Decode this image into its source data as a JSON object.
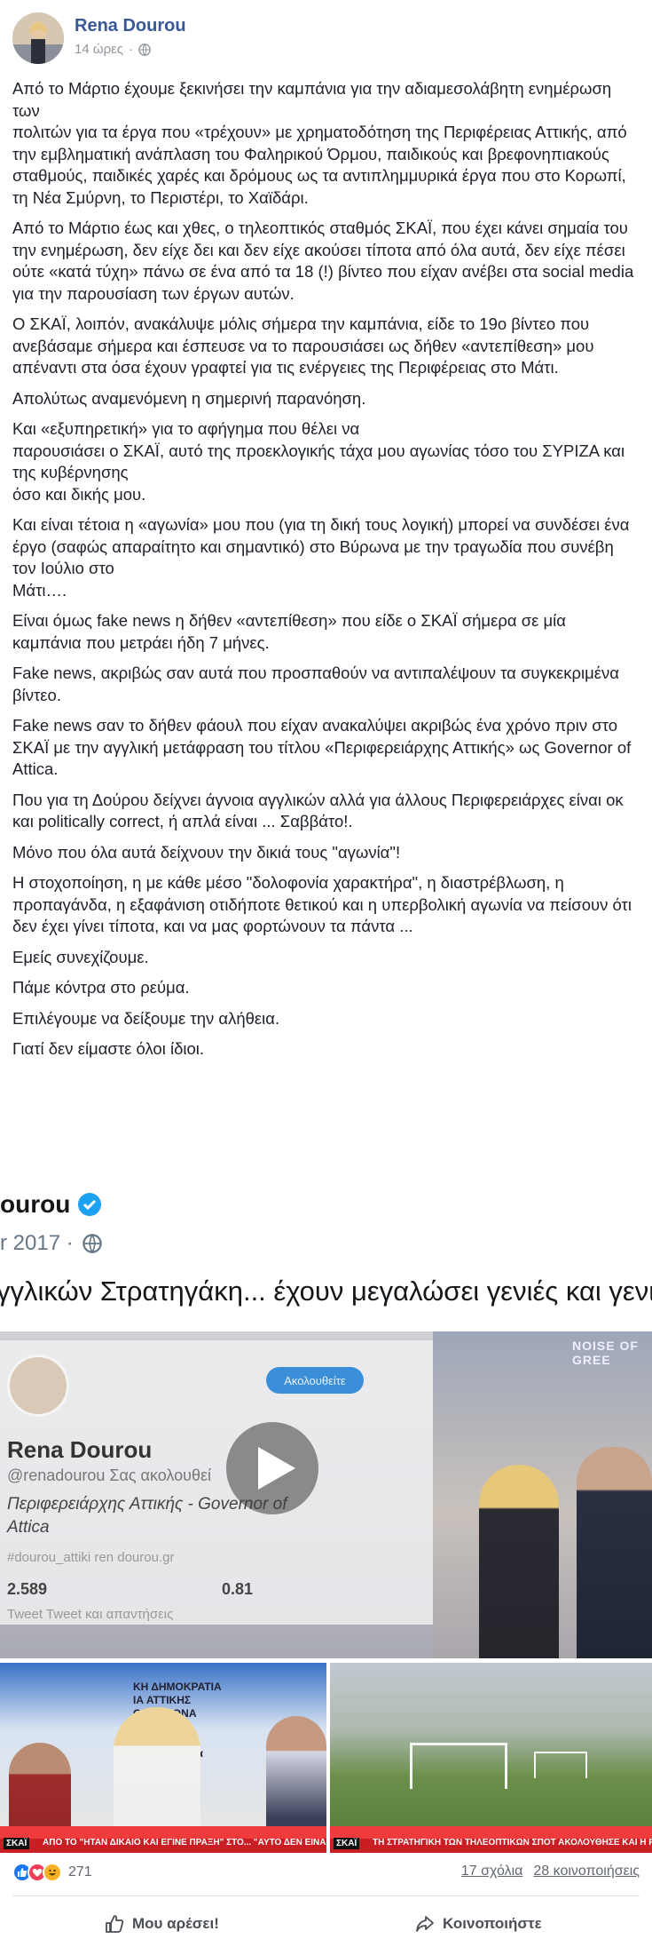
{
  "post": {
    "author": "Rena Dourou",
    "time": "14 ώρες",
    "privacy_icon": "globe-icon",
    "paragraphs": [
      "Από το Μάρτιο έχουμε ξεκινήσει την καμπάνια για την αδιαμεσολάβητη ενημέρωση των\nπολιτών για τα έργα που «τρέχουν» με χρηματοδότηση της Περιφέρειας Αττικής, από την εμβληματική ανάπλαση του Φαληρικού Όρμου, παιδικούς και βρεφονηπιακούς σταθμούς, παιδικές χαρές και δρόμους ως τα αντιπλημμυρικά έργα που στο Κορωπί, τη Νέα Σμύρνη, το Περιστέρι, το Χαϊδάρι.",
      "Από το Μάρτιο έως και χθες, ο τηλεοπτικός σταθμός ΣΚΑΪ, που έχει κάνει σημαία του την ενημέρωση, δεν είχε δει και δεν είχε ακούσει τίποτα από όλα αυτά, δεν είχε πέσει ούτε «κατά τύχη» πάνω σε ένα από τα 18 (!) βίντεο που είχαν ανέβει στα social media για την παρουσίαση των έργων αυτών.",
      "Ο ΣΚΑΪ, λοιπόν, ανακάλυψε μόλις σήμερα την καμπάνια, είδε το 19ο βίντεο που ανεβάσαμε σήμερα και έσπευσε να το παρουσιάσει ως δήθεν «αντεπίθεση» μου απέναντι στα όσα έχουν γραφτεί για τις ενέργειες της Περιφέρειας στο Μάτι.",
      "Απολύτως αναμενόμενη η σημερινή παρανόηση.",
      "Και «εξυπηρετική» για το αφήγημα που θέλει να\nπαρουσιάσει ο ΣΚΑΪ, αυτό της προεκλογικής τάχα μου αγωνίας τόσο του ΣΥΡΙΖΑ και της κυβέρνησης\nόσο και δικής μου.",
      "Και είναι τέτοια η «αγωνία» μου που (για τη δική τους λογική) μπορεί να συνδέσει ένα έργο (σαφώς απαραίτητο και σημαντικό) στο Βύρωνα με την τραγωδία που συνέβη τον Ιούλιο στο\nΜάτι….",
      "Είναι όμως fake news η δήθεν «αντεπίθεση» που είδε ο ΣΚΑΪ σήμερα σε μία καμπάνια που μετράει ήδη 7 μήνες.",
      "Fake news, ακριβώς σαν αυτά που προσπαθούν να αντιπαλέψουν τα συγκεκριμένα βίντεο.",
      "Fake news σαν το δήθεν φάουλ που είχαν ανακαλύψει ακριβώς ένα χρόνο πριν στο ΣΚΑΪ με την αγγλική μετάφραση του τίτλου «Περιφερειάρχης Αττικής» ως Governor of Attica.",
      "Που για τη Δούρου δείχνει άγνοια αγγλικών αλλά για άλλους Περιφερειάρχες είναι οκ και politically correct, ή απλά είναι ... Σαββάτο!.",
      "Μόνο που όλα αυτά δείχνουν την δικιά τους \"αγωνία\"!",
      "Η στοχοποίηση, η με κάθε μέσο \"δολοφονία χαρακτήρα\", η διαστρέβλωση, η προπαγάνδα, η εξαφάνιση οτιδήποτε θετικού και η υπερβολική αγωνία να πείσουν ότι δεν έχει γίνει τίποτα, και να μας φορτώνουν τα πάντα ...",
      "Εμείς συνεχίζουμε.",
      "Πάμε κόντρα στο ρεύμα.",
      "Επιλέγουμε να δείξουμε την αλήθεια.",
      "Γιατί δεν είμαστε όλοι ίδιοι."
    ]
  },
  "shared": {
    "tweet_name": "ourou",
    "tweet_date": "r 2017 ·",
    "tweet_text": "γγλικών Στρατηγάκη... έχουν μεγαλώσει γενιές και γενιές...",
    "video_overlay": {
      "follow_label": "Ακολουθείτε",
      "name": "Rena Dourou",
      "handle": "@renadourou  Σας ακολουθεί",
      "bio": "Περιφερειάρχης Αττικής - Governor of Attica",
      "links": "#dourou_attiki    ren dourou.gr",
      "count_left": "2.589",
      "count_right": "0.81",
      "tabs": "Tweet         Tweet και απαντήσεις",
      "studio_logo": "NOISE OF GREE"
    },
    "left_clip": {
      "sign_text": "ΚΗ ΔΗΜΟΚΡΑΤΙΑ\nΙΑ ΑΤΤΙΚΗΣ\nΟΣ ΒΥΡΩΝΑ\nΥΠΗΡΕΣΙΑ\nρέρεια Αττι\nήμος Βύρωνα\nσκεκ-Βελτ",
      "ticker_logo": "ΣΚΑΪ",
      "ticker": "ΑΠΟ ΤΟ \"ΗΤΑΝ ΔΙΚΑΙΟ ΚΑΙ ΕΓΙΝΕ ΠΡΑΞΗ\" ΣΤΟ... \"ΑΥΤΟ ΔΕΝ ΕΙΝΑΙ FAKE NEWS\""
    },
    "right_clip": {
      "ticker_logo": "ΣΚΑΪ",
      "ticker": "ΤΗ ΣΤΡΑΤΗΓΙΚΗ ΤΩΝ ΤΗΛΕΟΠΤΙΚΩΝ ΣΠΟΤ ΑΚΟΛΟΥΘΗΣΕ ΚΑΙ Η ΡΕΝΑ ΔΟΥΡΟΥ"
    }
  },
  "reactions": {
    "icons": [
      "like-reaction-icon",
      "love-reaction-icon",
      "haha-reaction-icon"
    ],
    "count": "271",
    "comments": "17 σχόλια",
    "shares": "28 κοινοποιήσεις"
  },
  "actions": {
    "like_label": "Μου αρέσει!",
    "share_label": "Κοινοποιήστε"
  },
  "colors": {
    "name_link": "#385898",
    "meta": "#90949c",
    "like_blue": "#1877f2",
    "love_red": "#f33e58",
    "haha_yellow": "#f7b125"
  }
}
